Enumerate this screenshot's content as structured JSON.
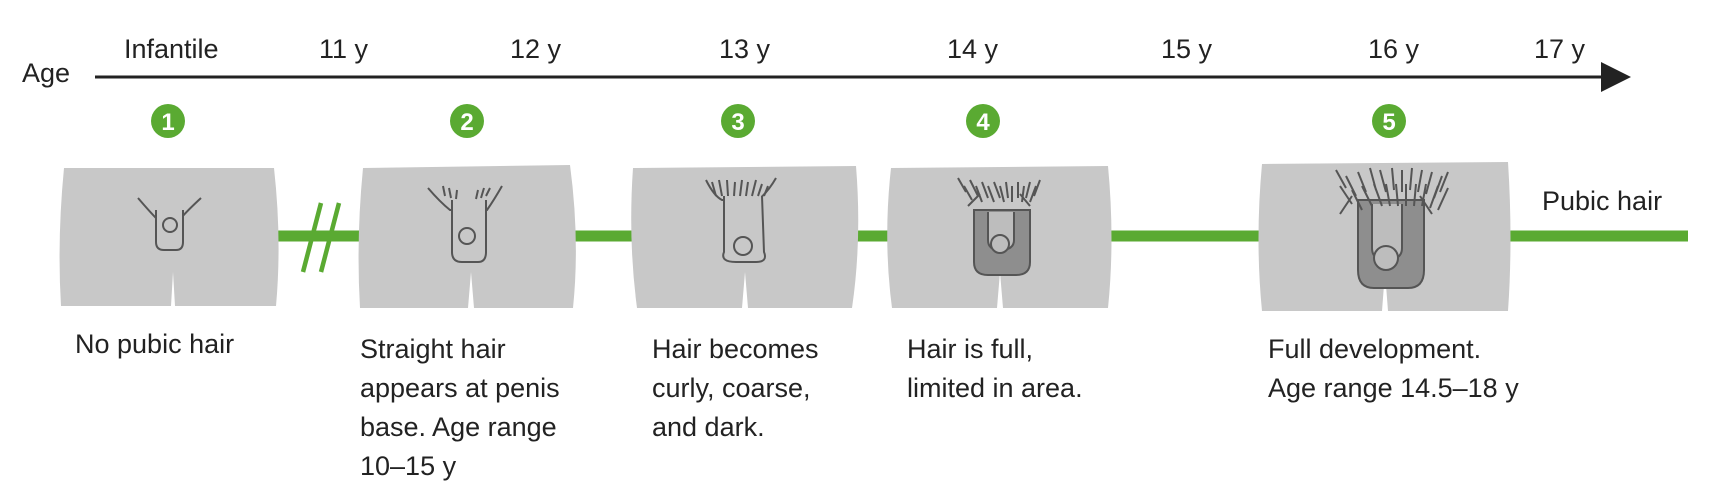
{
  "axis": {
    "label": "Age",
    "ticks": [
      "Infantile",
      "11 y",
      "12 y",
      "13 y",
      "14 y",
      "15 y",
      "16 y",
      "17 y"
    ]
  },
  "track_label": "Pubic hair",
  "stages": [
    {
      "number": "1",
      "description": [
        "No pubic hair"
      ]
    },
    {
      "number": "2",
      "description": [
        "Straight hair",
        "appears at penis",
        "base. Age range",
        "10–15 y"
      ]
    },
    {
      "number": "3",
      "description": [
        "Hair becomes",
        "curly, coarse,",
        "and dark."
      ]
    },
    {
      "number": "4",
      "description": [
        "Hair is full,",
        "limited in area."
      ]
    },
    {
      "number": "5",
      "description": [
        "Full development.",
        "Age range 14.5–18 y"
      ]
    }
  ],
  "colors": {
    "accent_green": "#5aaa32",
    "panel_gray": "#c8c8c8",
    "axis_dark": "#222222"
  }
}
